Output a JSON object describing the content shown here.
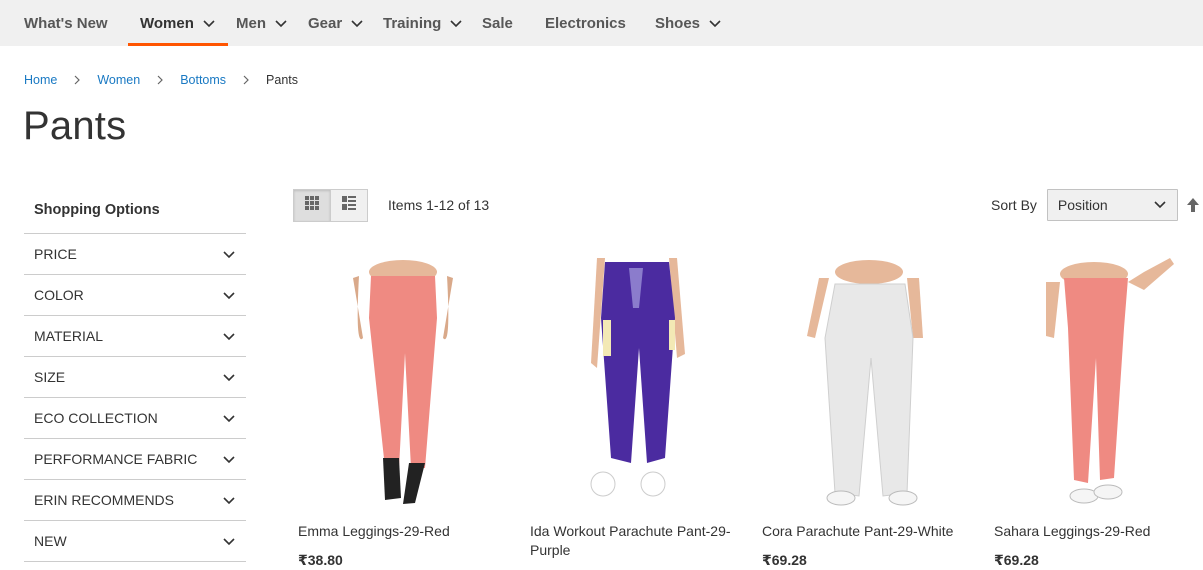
{
  "nav": {
    "items": [
      {
        "label": "What's New",
        "has_dropdown": false
      },
      {
        "label": "Women",
        "has_dropdown": true,
        "active": true
      },
      {
        "label": "Men",
        "has_dropdown": true
      },
      {
        "label": "Gear",
        "has_dropdown": true
      },
      {
        "label": "Training",
        "has_dropdown": true
      },
      {
        "label": "Sale",
        "has_dropdown": false
      },
      {
        "label": "Electronics",
        "has_dropdown": false
      },
      {
        "label": "Shoes",
        "has_dropdown": true
      }
    ]
  },
  "breadcrumb": [
    "Home",
    "Women",
    "Bottoms",
    "Pants"
  ],
  "page_title": "Pants",
  "sidebar": {
    "title": "Shopping Options",
    "filters": [
      "PRICE",
      "COLOR",
      "MATERIAL",
      "SIZE",
      "ECO COLLECTION",
      "PERFORMANCE FABRIC",
      "ERIN RECOMMENDS",
      "NEW"
    ]
  },
  "toolbar": {
    "items_count": "Items 1-12 of 13",
    "sort_label": "Sort By",
    "sort_value": "Position"
  },
  "products": [
    {
      "name": "Emma Leggings-29-Red",
      "price": "₹38.80",
      "color": "#ef8a82"
    },
    {
      "name": "Ida Workout Parachute Pant-29-Purple",
      "price": "",
      "color": "#4b2ba0"
    },
    {
      "name": "Cora Parachute Pant-29-White",
      "price": "₹69.28",
      "color": "#e8e8e8"
    },
    {
      "name": "Sahara Leggings-29-Red",
      "price": "₹69.28",
      "color": "#ef8a82"
    }
  ],
  "colors": {
    "accent": "#ff5501",
    "link": "#1979c3"
  }
}
